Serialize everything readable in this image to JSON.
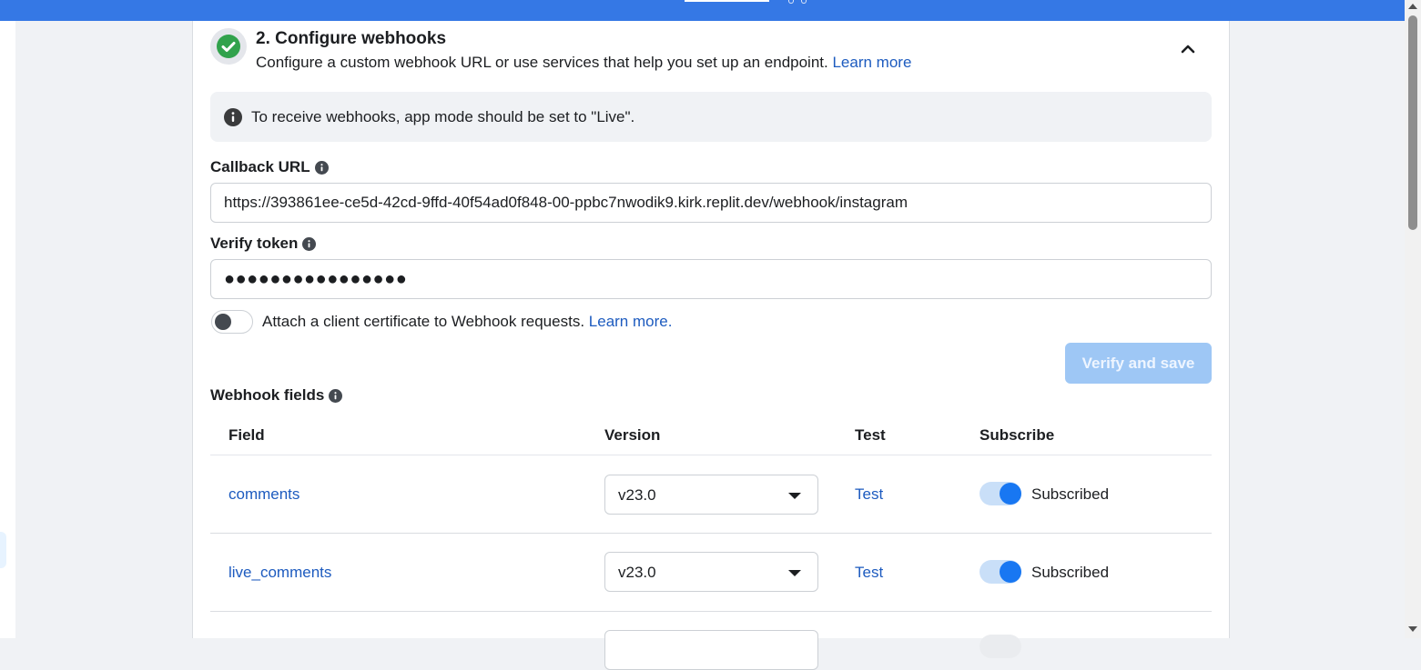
{
  "step": {
    "title": "2. Configure webhooks",
    "subtitle": "Configure a custom webhook URL or use services that help you set up an endpoint.",
    "learn_more": "Learn more"
  },
  "notice": {
    "text": "To receive webhooks, app mode should be set to \"Live\"."
  },
  "callback": {
    "label": "Callback URL",
    "value": "https://393861ee-ce5d-42cd-9ffd-40f54ad0f848-00-ppbc7nwodik9.kirk.replit.dev/webhook/instagram"
  },
  "verify_token": {
    "label": "Verify token",
    "value": "●●●●●●●●●●●●●●●●"
  },
  "certificate": {
    "text": "Attach a client certificate to Webhook requests.",
    "learn_more": "Learn more",
    "period": "."
  },
  "buttons": {
    "verify_save": "Verify and save"
  },
  "webhook_fields": {
    "label": "Webhook fields",
    "columns": {
      "field": "Field",
      "version": "Version",
      "test": "Test",
      "subscribe": "Subscribe"
    },
    "rows": [
      {
        "field": "comments",
        "version": "v23.0",
        "test": "Test",
        "status": "Subscribed"
      },
      {
        "field": "live_comments",
        "version": "v23.0",
        "test": "Test",
        "status": "Subscribed"
      }
    ]
  },
  "colors": {
    "accent": "#1877f2",
    "topbar": "#3578e5",
    "success": "#31a24c",
    "link": "#1d5bbf"
  }
}
